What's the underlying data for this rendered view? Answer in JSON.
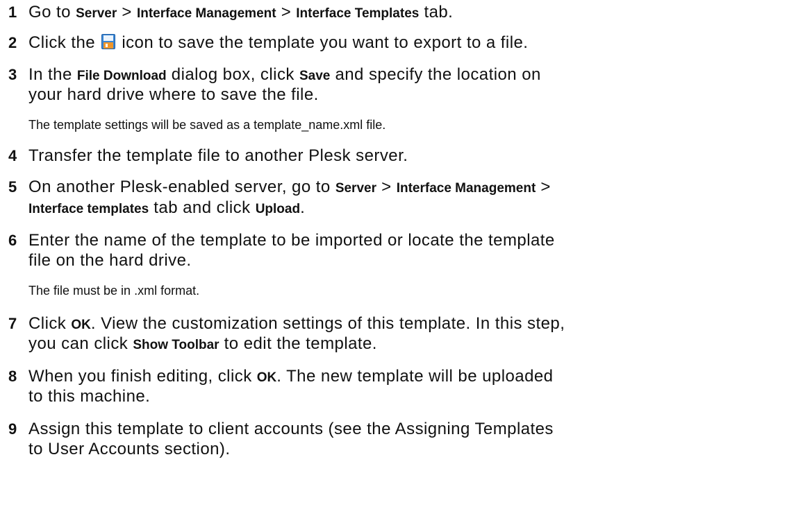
{
  "steps": [
    {
      "number": "1",
      "line1": {
        "t1": "Go to ",
        "b1": "Server",
        "t2": " > ",
        "b2": "Interface Management",
        "t3": " > ",
        "b3": "Interface Templates",
        "t4": " tab."
      }
    },
    {
      "number": "2",
      "line1": {
        "t1": "Click the ",
        "icon": "save-icon",
        "t2": " icon to save the template you want to export to a file."
      }
    },
    {
      "number": "3",
      "line1": {
        "t1": "In the ",
        "b1": "File Download",
        "t2": " dialog box, click ",
        "b2": "Save",
        "t3": " and specify the location on"
      },
      "line2": "your hard drive where to save the file.",
      "note": "The template settings will be saved as a template_name.xml file."
    },
    {
      "number": "4",
      "line1": {
        "t1": "Transfer the template file to another Plesk server."
      }
    },
    {
      "number": "5",
      "line1": {
        "t1": "On another Plesk-enabled server, go to ",
        "b1": "Server",
        "t2": " > ",
        "b2": "Interface Management",
        "t3": " >"
      },
      "line2": {
        "b1": "Interface templates",
        "t1": " tab and click ",
        "b2": "Upload",
        "t2": "."
      }
    },
    {
      "number": "6",
      "line1": {
        "t1": "Enter the name of the template to be imported or locate the template"
      },
      "line2": "file on the hard drive.",
      "note": "The file must be in .xml format."
    },
    {
      "number": "7",
      "line1": {
        "t1": "Click ",
        "b1": "OK",
        "t2": ". View the customization settings of this template. In this step,"
      },
      "line2": {
        "t1": "you can click ",
        "b1": "Show Toolbar",
        "t2": " to edit the template."
      }
    },
    {
      "number": "8",
      "line1": {
        "t1": "When you finish editing, click ",
        "b1": "OK",
        "t2": ". The new template will be uploaded"
      },
      "line2": "to this machine."
    },
    {
      "number": "9",
      "line1": {
        "t1": "Assign this template to client accounts (see the Assigning Templates"
      },
      "line2": "to User Accounts section)."
    }
  ],
  "colors": {
    "text": "#111111",
    "icon_blue": "#3a86d4",
    "icon_orange": "#f0962a"
  }
}
